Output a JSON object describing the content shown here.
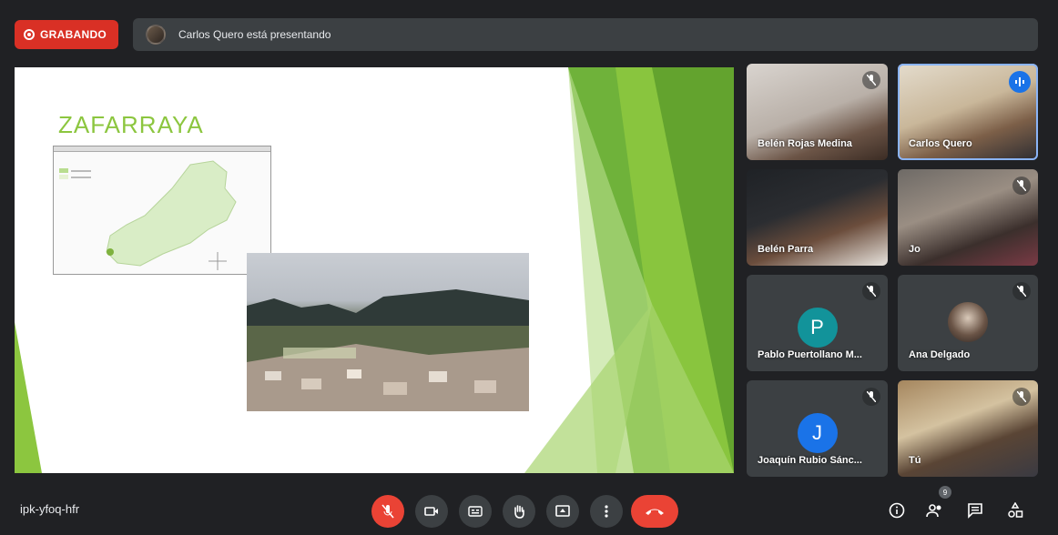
{
  "top": {
    "recording_label": "GRABANDO",
    "presenting_text": "Carlos Quero está presentando"
  },
  "slide": {
    "title": "ZAFARRAYA",
    "accent_color": "#8cc63f"
  },
  "participants": [
    {
      "name": "Belén Rojas Medina",
      "type": "video",
      "muted": true
    },
    {
      "name": "Carlos Quero",
      "type": "video",
      "speaking": true
    },
    {
      "name": "Belén Parra",
      "type": "video",
      "muted": false
    },
    {
      "name": "Jo",
      "type": "video",
      "muted": true
    },
    {
      "name": "Pablo Puertollano M...",
      "type": "letter",
      "letter": "P",
      "color": "#12939a",
      "muted": true
    },
    {
      "name": "Ana Delgado",
      "type": "photo-avatar",
      "muted": true
    },
    {
      "name": "Joaquín Rubio Sánc...",
      "type": "letter",
      "letter": "J",
      "color": "#1a73e8",
      "muted": true
    },
    {
      "name": "Tú",
      "type": "video",
      "muted": true
    }
  ],
  "bottom": {
    "meeting_code": "ipk-yfoq-hfr",
    "participant_count": "9"
  }
}
